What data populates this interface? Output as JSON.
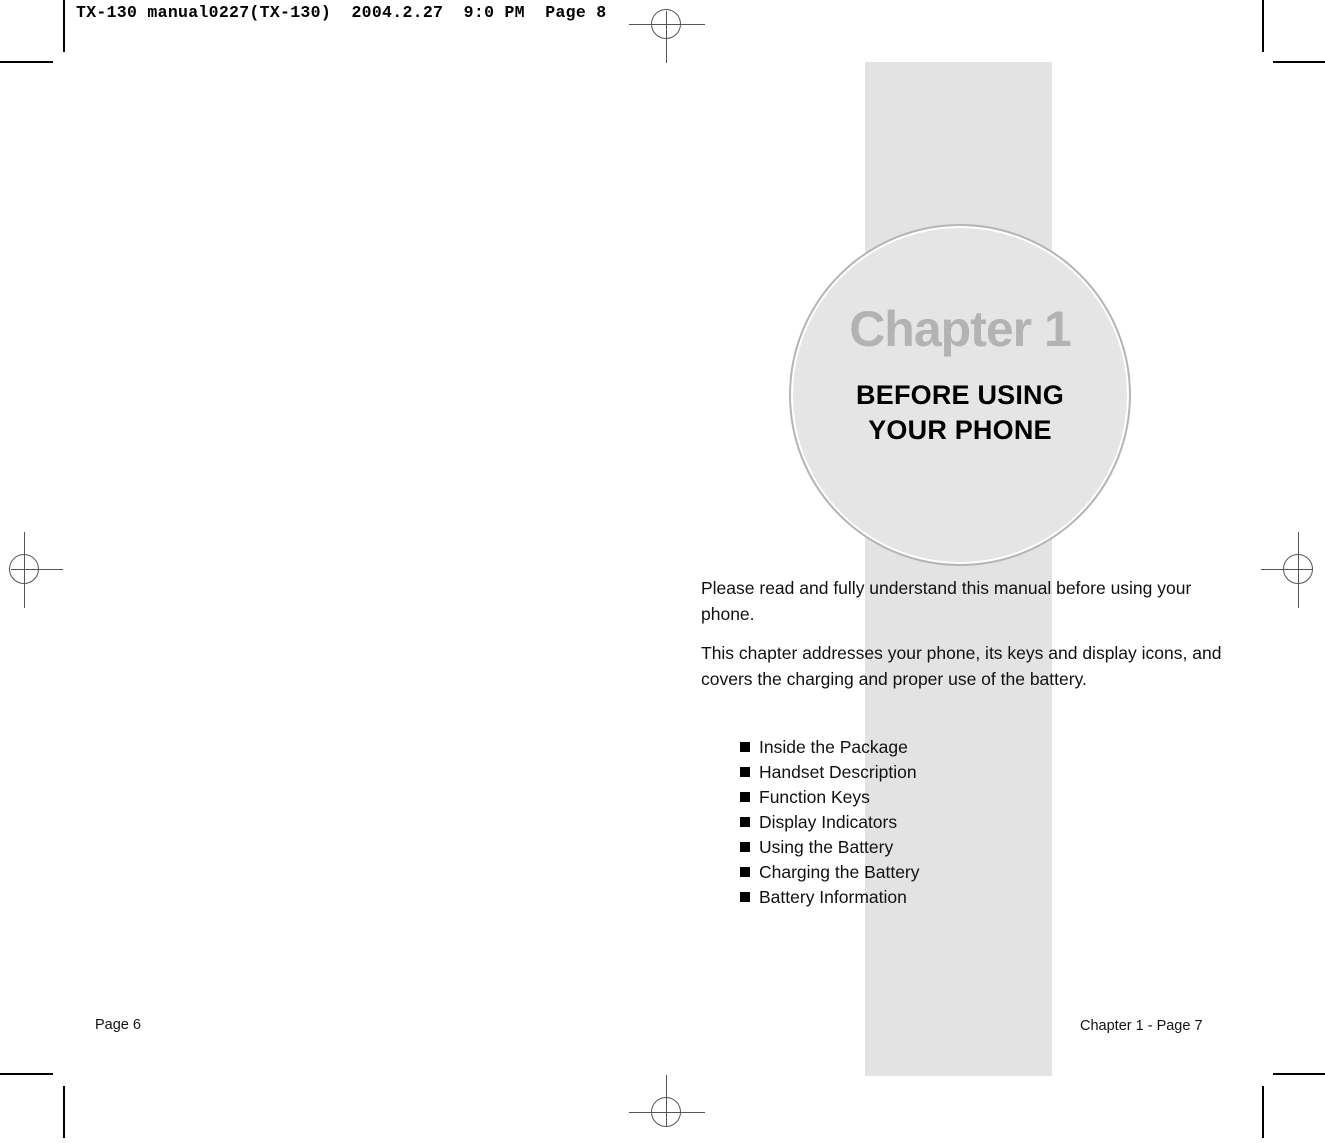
{
  "slug": {
    "text": "TX-130 manual0227(TX-130)  2004.2.27  9:0 PM  Page 8"
  },
  "chapter": {
    "kicker": "Chapter 1",
    "title": "BEFORE USING\nYOUR PHONE"
  },
  "body": {
    "paragraphs": [
      "Please read and fully understand this manual before using your phone.",
      "This chapter addresses your phone, its keys and display icons, and covers the charging and proper use of the battery."
    ]
  },
  "contents": {
    "items": [
      "Inside the Package",
      "Handset Description",
      "Function Keys",
      "Display Indicators",
      "Using the Battery",
      "Charging the Battery",
      "Battery Information"
    ]
  },
  "footer": {
    "left": "Page 6",
    "right": "Chapter 1 - Page 7"
  },
  "colors": {
    "band_gray": "#e3e3e3",
    "circle_fill": "#e5e5e5",
    "circle_ring": "#b5b5b5",
    "kicker_gray": "#b3b3b3",
    "text_black": "#111111"
  }
}
